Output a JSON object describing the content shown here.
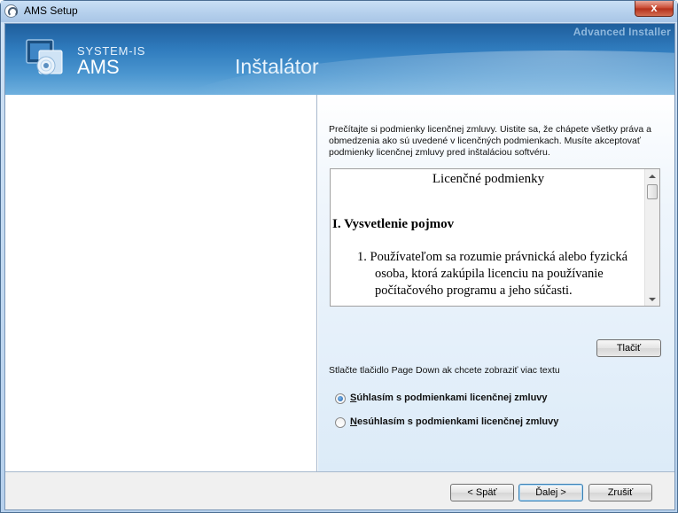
{
  "window": {
    "title": "AMS Setup",
    "close_label": "x"
  },
  "banner": {
    "watermark": "Advanced Installer",
    "brand_top": "SYSTEM-IS",
    "brand_name": "AMS",
    "page_title": "Inštalátor"
  },
  "license": {
    "intro": "Prečítajte si podmienky licenčnej zmluvy. Uistite sa, že chápete všetky práva a obmedzenia ako sú uvedené v licenčných podmienkach. Musíte akceptovať podmienky licenčnej zmluvy pred inštaláciou softvéru.",
    "doc_title": "Licenčné podmienky",
    "section_heading": "I. Vysvetlenie pojmov",
    "item_1": "1.  Používateľom sa rozumie právnická alebo fyzická osoba, ktorá zakúpila licenciu na používanie počítačového programu a jeho súčasti.",
    "print_button": "Tlačiť",
    "pagedown_hint": "Stlačte tlačidlo Page Down ak chcete zobraziť viac textu",
    "accept_mnemonic": "S",
    "accept_rest": "úhlasím s podmienkami licenčnej zmluvy",
    "decline_mnemonic": "N",
    "decline_rest": "esúhlasím s podmienkami licenčnej zmluvy",
    "accept_selected": true
  },
  "footer": {
    "back": "< Späť",
    "next": "Ďalej >",
    "cancel": "Zrušiť"
  },
  "colors": {
    "banner_dark": "#1f5e9c",
    "banner_light": "#6fb0de",
    "close_red": "#c8452d"
  }
}
